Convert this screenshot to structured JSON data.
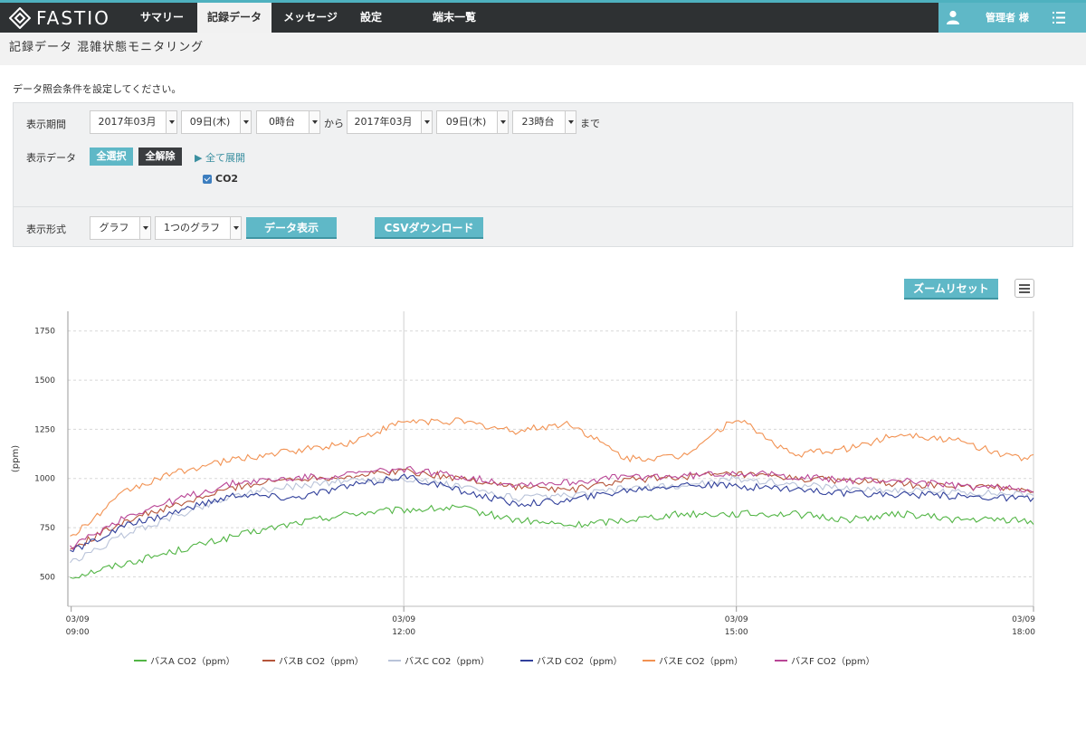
{
  "app": {
    "logo_text": "FASTIO"
  },
  "nav": {
    "items": [
      {
        "label": "サマリー"
      },
      {
        "label": "記録データ"
      },
      {
        "label": "メッセージ"
      },
      {
        "label": "設定"
      },
      {
        "label": "端末一覧"
      }
    ],
    "active_index": 1,
    "user": "管理者 様"
  },
  "page": {
    "title": "記録データ  混雑状態モニタリング",
    "instruction": "データ照会条件を設定してください。"
  },
  "filters": {
    "period_label": "表示期間",
    "from": {
      "month": "2017年03月",
      "day": "09日(木)",
      "hour": "0時台"
    },
    "from_sep": "から",
    "to": {
      "month": "2017年03月",
      "day": "09日(木)",
      "hour": "23時台"
    },
    "to_sep": "まで",
    "data_label": "表示データ",
    "select_all": "全選択",
    "deselect_all": "全解除",
    "expand_all": "▶ 全て展開",
    "checkbox_co2": "CO2",
    "format_label": "表示形式",
    "format_type": "グラフ",
    "graph_count": "1つのグラフ",
    "show_data": "データ表示",
    "csv_download": "CSVダウンロード"
  },
  "chart_controls": {
    "zoom_reset": "ズームリセット"
  },
  "colors": {
    "accent": "#5fb8c7",
    "nav_bg": "#2e3133"
  },
  "chart_data": {
    "type": "line",
    "title": "",
    "xlabel": "",
    "ylabel": "(ppm)",
    "ylim": [
      350,
      1850
    ],
    "yticks": [
      500,
      750,
      1000,
      1250,
      1500,
      1750
    ],
    "x_range_hours": [
      8.97,
      17.68
    ],
    "xticks": [
      {
        "h": 9,
        "date": "03/09",
        "time": "09:00"
      },
      {
        "h": 12,
        "date": "03/09",
        "time": "12:00"
      },
      {
        "h": 15,
        "date": "03/09",
        "time": "15:00"
      },
      {
        "h": 18,
        "date": "03/09",
        "time": "18:00"
      }
    ],
    "x": [
      "09:00",
      "09:30",
      "10:00",
      "10:30",
      "11:00",
      "11:30",
      "12:00",
      "12:30",
      "13:00",
      "13:30",
      "14:00",
      "14:30",
      "15:00",
      "15:30",
      "16:00",
      "16:30",
      "17:00",
      "17:30",
      "18:00"
    ],
    "series": [
      {
        "name": "バスA CO2（ppm）",
        "color": "#52b545",
        "values": [
          500,
          570,
          640,
          710,
          770,
          820,
          840,
          850,
          790,
          760,
          790,
          820,
          820,
          820,
          790,
          820,
          790,
          790,
          760
        ]
      },
      {
        "name": "バスB CO2（ppm）",
        "color": "#b5553a",
        "values": [
          640,
          790,
          870,
          960,
          1000,
          1010,
          1040,
          1000,
          960,
          940,
          990,
          1010,
          1020,
          1000,
          990,
          970,
          960,
          950,
          920
        ]
      },
      {
        "name": "バスC CO2（ppm）",
        "color": "#b9c3d9",
        "values": [
          570,
          720,
          820,
          920,
          960,
          990,
          1000,
          960,
          900,
          910,
          950,
          960,
          1000,
          970,
          950,
          940,
          930,
          920,
          900
        ]
      },
      {
        "name": "バスD CO2（ppm）",
        "color": "#31409b",
        "values": [
          630,
          760,
          840,
          920,
          900,
          960,
          1010,
          940,
          870,
          890,
          940,
          970,
          960,
          950,
          920,
          920,
          910,
          900,
          880
        ]
      },
      {
        "name": "バスE CO2（ppm）",
        "color": "#f29252",
        "values": [
          700,
          940,
          1040,
          1100,
          1140,
          1180,
          1290,
          1290,
          1240,
          1280,
          1100,
          1110,
          1310,
          1120,
          1150,
          1230,
          1190,
          1110,
          1100
        ]
      },
      {
        "name": "バスF CO2（ppm）",
        "color": "#b94696",
        "values": [
          650,
          810,
          900,
          980,
          1000,
          1020,
          1050,
          1010,
          970,
          980,
          1010,
          1010,
          1030,
          1010,
          990,
          990,
          960,
          950,
          930
        ]
      }
    ],
    "legend_position": "bottom",
    "grid": true
  }
}
